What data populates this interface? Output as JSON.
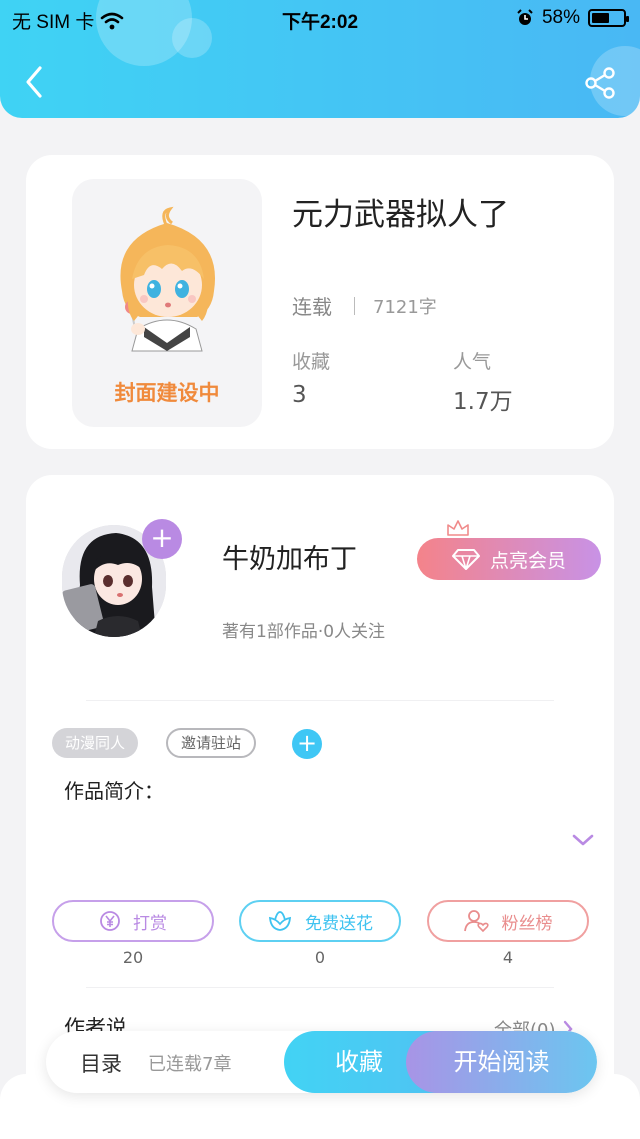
{
  "status_bar": {
    "carrier": "无 SIM 卡",
    "time": "下午2:02",
    "battery": "58%",
    "battery_level": 0.58
  },
  "book": {
    "title": "元力武器拟人了",
    "status": "连载",
    "word_count": "7121字",
    "cover_text": "封面建设中",
    "stats": [
      {
        "label": "收藏",
        "value": "3"
      },
      {
        "label": "人气",
        "value": "1.7万"
      }
    ]
  },
  "author": {
    "name": "牛奶加布丁",
    "subtitle": "著有1部作品·0人关注",
    "follow_symbol": "+",
    "vip_label": "点亮会员"
  },
  "tags": [
    "动漫同人",
    "邀请驻站"
  ],
  "intro": {
    "title": "作品简介："
  },
  "actions": [
    {
      "label": "打赏",
      "count": "20",
      "icon": "yen-coin-icon"
    },
    {
      "label": "免费送花",
      "count": "0",
      "icon": "flower-icon"
    },
    {
      "label": "粉丝榜",
      "count": "4",
      "icon": "user-heart-icon"
    }
  ],
  "author_say": {
    "title": "作者说",
    "all_label": "全部(0)"
  },
  "bottom_bar": {
    "toc": "目录",
    "chapters": "已连载7章",
    "collect": "收藏",
    "read": "开始阅读"
  },
  "colors": {
    "header": "#3fd3f4",
    "purple": "#b98ae3",
    "cyan": "#3fc3f0",
    "coral": "#e98d8d",
    "orange": "#f08a3c"
  }
}
